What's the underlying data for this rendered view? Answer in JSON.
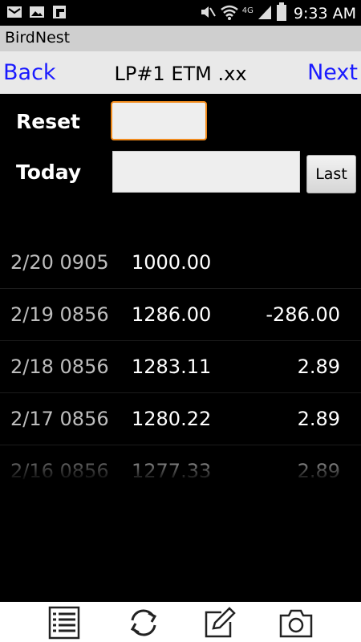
{
  "status_bar": {
    "network": "4G",
    "time": "9:33 AM",
    "icons": [
      "mail-icon",
      "image-icon",
      "flipboard-icon",
      "mute-icon",
      "wifi-icon",
      "signal-icon",
      "battery-icon"
    ]
  },
  "app": {
    "title": "BirdNest"
  },
  "nav": {
    "back_label": "Back",
    "title": "LP#1 ETM .xx",
    "next_label": "Next"
  },
  "form": {
    "reset_label": "Reset",
    "reset_value": "",
    "today_label": "Today",
    "today_value": "",
    "last_button": "Last"
  },
  "entries": [
    {
      "date": "2/20 0905",
      "value": "1000.00",
      "change": ""
    },
    {
      "date": "2/19 0856",
      "value": "1286.00",
      "change": "-286.00"
    },
    {
      "date": "2/18 0856",
      "value": "1283.11",
      "change": "2.89"
    },
    {
      "date": "2/17 0856",
      "value": "1280.22",
      "change": "2.89"
    },
    {
      "date": "2/16 0856",
      "value": "1277.33",
      "change": "2.89"
    }
  ],
  "toolbar": {
    "icons": [
      "list-icon",
      "refresh-icon",
      "edit-icon",
      "camera-icon"
    ]
  },
  "colors": {
    "link": "#1a1aff",
    "focus_border": "#f08a1c",
    "background": "#000000"
  }
}
